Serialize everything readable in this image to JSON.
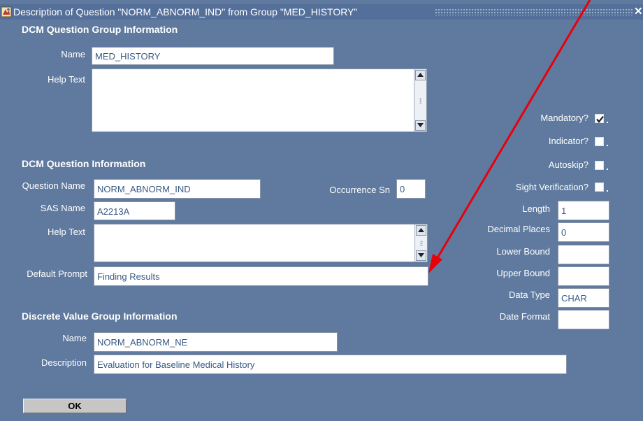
{
  "window": {
    "title": "Description of Question \"NORM_ABNORM_IND\" from Group \"MED_HISTORY\"",
    "close_symbol": "✕"
  },
  "group_info": {
    "heading": "DCM Question Group Information",
    "name_label": "Name",
    "name_value": "MED_HISTORY",
    "help_label": "Help Text",
    "help_value": ""
  },
  "question_info": {
    "heading": "DCM Question Information",
    "question_name_label": "Question Name",
    "question_name_value": "NORM_ABNORM_IND",
    "occurrence_label": "Occurrence Sn",
    "occurrence_value": "0",
    "sas_label": "SAS Name",
    "sas_value": "A2213A",
    "help_label": "Help Text",
    "help_value": "",
    "prompt_label": "Default Prompt",
    "prompt_value": "Finding Results"
  },
  "flags": {
    "mandatory_label": "Mandatory?",
    "mandatory_checked": true,
    "indicator_label": "Indicator?",
    "indicator_checked": false,
    "autoskip_label": "Autoskip?",
    "autoskip_checked": false,
    "sight_label": "Sight Verification?",
    "sight_checked": false
  },
  "attributes": {
    "length_label": "Length",
    "length_value": "1",
    "decimal_label": "Decimal Places",
    "decimal_value": "0",
    "lower_label": "Lower Bound",
    "lower_value": "",
    "upper_label": "Upper Bound",
    "upper_value": "",
    "datatype_label": "Data Type",
    "datatype_value": "CHAR",
    "dateformat_label": "Date Format",
    "dateformat_value": ""
  },
  "dvg_info": {
    "heading": "Discrete Value Group Information",
    "name_label": "Name",
    "name_value": "NORM_ABNORM_NE",
    "desc_label": "Description",
    "desc_value": "Evaluation for Baseline Medical History"
  },
  "buttons": {
    "ok_label": "OK"
  },
  "colors": {
    "window_bg": "#5f7a9e",
    "field_text": "#3a5a85",
    "annotation_arrow": "#e8000b"
  },
  "icons": [
    "app-icon",
    "close-icon",
    "scroll-up-icon",
    "scroll-down-icon",
    "checkmark-icon",
    "annotation-arrow"
  ]
}
